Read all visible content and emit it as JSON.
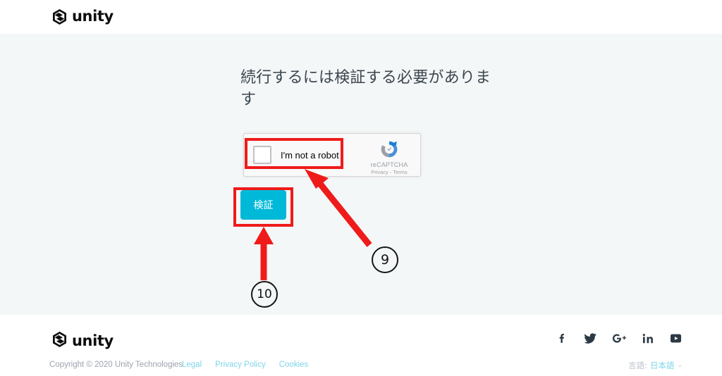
{
  "header": {
    "logo_text": "unity",
    "logo_icon": "unity-cube-icon"
  },
  "main": {
    "title": "続行するには検証する必要があります",
    "recaptcha": {
      "checkbox_label": "I'm not a robot",
      "brand_name": "reCAPTCHA",
      "brand_links": "Privacy - Terms",
      "logo_icon": "recaptcha-circular-arrows-icon",
      "checked": false
    },
    "verify_button_label": "検証"
  },
  "annotations": {
    "markers": [
      {
        "id": "marker-9",
        "label": "⑨",
        "text": "9",
        "target": "recaptcha-checkbox"
      },
      {
        "id": "marker-10",
        "label": "⑩",
        "text": "10",
        "target": "verify-button"
      }
    ],
    "highlight_color": "#ef1b1b",
    "arrow_color": "#ef1b1b"
  },
  "footer": {
    "logo_text": "unity",
    "copyright": "Copyright © 2020 Unity Technologies",
    "links": [
      {
        "label": "Legal"
      },
      {
        "label": "Privacy Policy"
      },
      {
        "label": "Cookies"
      }
    ],
    "social": [
      {
        "name": "facebook-icon",
        "glyph": "f"
      },
      {
        "name": "twitter-icon",
        "glyph": "twitter"
      },
      {
        "name": "google-plus-icon",
        "glyph": "g+"
      },
      {
        "name": "linkedin-icon",
        "glyph": "in"
      },
      {
        "name": "youtube-icon",
        "glyph": "youtube"
      }
    ],
    "language": {
      "label": "言語:",
      "value": "日本語",
      "caret": "⌄"
    }
  },
  "colors": {
    "page_background": "#f4f7f7",
    "panel_background": "#ffffff",
    "accent_cyan": "#00b9d8",
    "link_blue": "#7fd5ea",
    "title_text": "#3c4650",
    "annotation_red": "#ef1b1b"
  }
}
